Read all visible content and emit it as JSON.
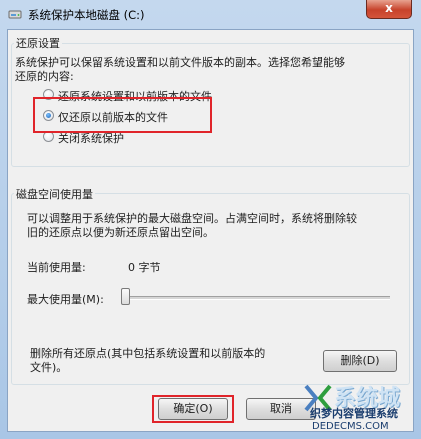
{
  "window": {
    "title": "系统保护本地磁盘 (C:)",
    "close_label": "x"
  },
  "restore": {
    "group_label": "还原设置",
    "description_line1": "系统保护可以保留系统设置和以前文件版本的副本。选择您希望能够",
    "description_line2": "还原的内容:",
    "options": [
      {
        "label": "还原系统设置和以前版本的文件",
        "checked": false
      },
      {
        "label": "仅还原以前版本的文件",
        "checked": true
      },
      {
        "label": "关闭系统保护",
        "checked": false
      }
    ]
  },
  "disk": {
    "group_label": "磁盘空间使用量",
    "description_line1": "可以调整用于系统保护的最大磁盘空间。占满空间时，系统将删除较",
    "description_line2": "旧的还原点以便为新还原点留出空间。",
    "current_usage_label": "当前使用量:",
    "current_usage_value": "0 字节",
    "max_usage_label": "最大使用量(M):",
    "max_usage_fraction": 0.0,
    "delete_description_line1": "删除所有还原点(其中包括系统设置和以前版本的",
    "delete_description_line2": "文件)。",
    "delete_button_label": "删除(D)"
  },
  "footer": {
    "ok_label": "确定(O)",
    "cancel_label": "取消"
  },
  "watermark": {
    "big_text": "系统城",
    "mid_text": "织梦内容管理系统",
    "small_text": "DEDECMS.COM"
  },
  "colors": {
    "highlight": "#e0242a",
    "titlebar": "#b9d1ea",
    "close_button": "#c7432b"
  }
}
